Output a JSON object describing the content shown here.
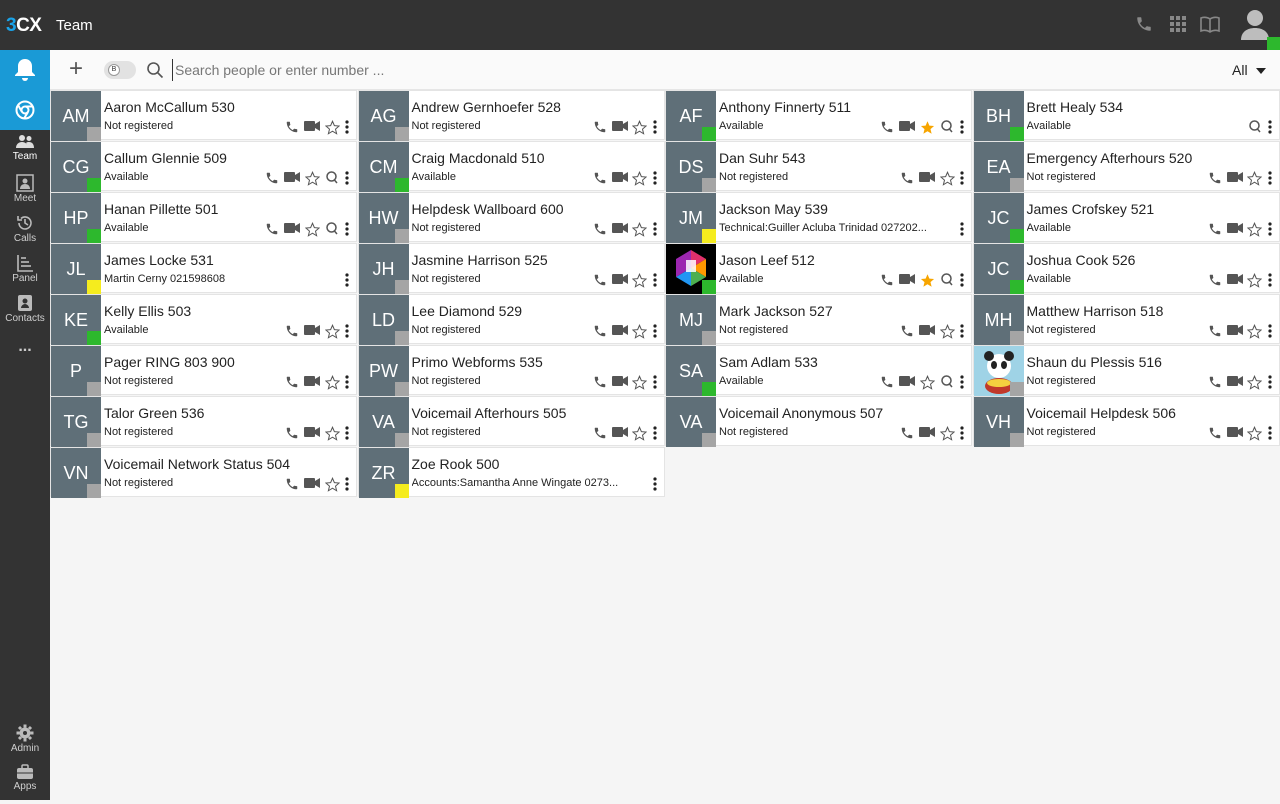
{
  "app": {
    "logo_3": "3",
    "logo_cx": "CX",
    "title": "Team"
  },
  "sidebar": {
    "items": [
      {
        "name": "notifications",
        "label": ""
      },
      {
        "name": "chrome-extension",
        "label": ""
      },
      {
        "name": "team",
        "label": "Team"
      },
      {
        "name": "meet",
        "label": "Meet"
      },
      {
        "name": "calls",
        "label": "Calls"
      },
      {
        "name": "panel",
        "label": "Panel"
      },
      {
        "name": "contacts",
        "label": "Contacts"
      },
      {
        "name": "more",
        "label": "..."
      },
      {
        "name": "admin",
        "label": "Admin"
      },
      {
        "name": "apps",
        "label": "Apps"
      }
    ]
  },
  "toolbar": {
    "add": "+",
    "toggle_label": "B",
    "search_placeholder": "Search people or enter number ...",
    "filter": "All"
  },
  "colors": {
    "topbar": "#333333",
    "accent": "#1a9ad6",
    "available": "#2db82d",
    "offline": "#a5a5a5",
    "busy": "#f5ec1e",
    "favorite": "#f7a500"
  },
  "contacts": [
    {
      "initials": "AM",
      "name": "Aaron McCallum 530",
      "status": "Not registered",
      "presence": "gray",
      "actions": [
        "phone",
        "video",
        "star",
        "more"
      ]
    },
    {
      "initials": "AG",
      "name": "Andrew Gernhoefer 528",
      "status": "Not registered",
      "presence": "gray",
      "actions": [
        "phone",
        "video",
        "star",
        "more"
      ]
    },
    {
      "initials": "AF",
      "name": "Anthony Finnerty 511",
      "status": "Available",
      "presence": "green",
      "actions": [
        "phone",
        "video",
        "star-filled",
        "queue",
        "more"
      ]
    },
    {
      "initials": "BH",
      "name": "Brett Healy 534",
      "status": "Available",
      "presence": "green",
      "actions": [
        "queue",
        "more"
      ]
    },
    {
      "initials": "CG",
      "name": "Callum Glennie 509",
      "status": "Available",
      "presence": "green",
      "actions": [
        "phone",
        "video",
        "star",
        "queue",
        "more"
      ]
    },
    {
      "initials": "CM",
      "name": "Craig Macdonald 510",
      "status": "Available",
      "presence": "green",
      "actions": [
        "phone",
        "video",
        "star",
        "more"
      ]
    },
    {
      "initials": "DS",
      "name": "Dan Suhr 543",
      "status": "Not registered",
      "presence": "gray",
      "actions": [
        "phone",
        "video",
        "star",
        "more"
      ]
    },
    {
      "initials": "EA",
      "name": "Emergency Afterhours 520",
      "status": "Not registered",
      "presence": "gray",
      "actions": [
        "phone",
        "video",
        "star",
        "more"
      ]
    },
    {
      "initials": "HP",
      "name": "Hanan Pillette 501",
      "status": "Available",
      "presence": "green",
      "actions": [
        "phone",
        "video",
        "star",
        "queue",
        "more"
      ]
    },
    {
      "initials": "HW",
      "name": "Helpdesk Wallboard 600",
      "status": "Not registered",
      "presence": "gray",
      "actions": [
        "phone",
        "video",
        "star",
        "more"
      ]
    },
    {
      "initials": "JM",
      "name": "Jackson May 539",
      "status": "Technical:Guiller Acluba Trinidad 027202...",
      "presence": "yellow",
      "actions": [
        "more"
      ]
    },
    {
      "initials": "JC",
      "name": "James Crofskey 521",
      "status": "Available",
      "presence": "green",
      "actions": [
        "phone",
        "video",
        "star",
        "more"
      ]
    },
    {
      "initials": "JL",
      "name": "James Locke 531",
      "status": "Martin Cerny 021598608",
      "presence": "yellow",
      "actions": [
        "more"
      ]
    },
    {
      "initials": "JH",
      "name": "Jasmine Harrison 525",
      "status": "Not registered",
      "presence": "gray",
      "actions": [
        "phone",
        "video",
        "star",
        "more"
      ]
    },
    {
      "initials": "",
      "name": "Jason Leef 512",
      "status": "Available",
      "presence": "green",
      "avatar": "logo",
      "actions": [
        "phone",
        "video",
        "star-filled",
        "queue",
        "more"
      ]
    },
    {
      "initials": "JC",
      "name": "Joshua Cook 526",
      "status": "Available",
      "presence": "green",
      "actions": [
        "phone",
        "video",
        "star",
        "more"
      ]
    },
    {
      "initials": "KE",
      "name": "Kelly Ellis 503",
      "status": "Available",
      "presence": "green",
      "actions": [
        "phone",
        "video",
        "star",
        "more"
      ]
    },
    {
      "initials": "LD",
      "name": "Lee Diamond 529",
      "status": "Not registered",
      "presence": "gray",
      "actions": [
        "phone",
        "video",
        "star",
        "more"
      ]
    },
    {
      "initials": "MJ",
      "name": "Mark Jackson 527",
      "status": "Not registered",
      "presence": "gray",
      "actions": [
        "phone",
        "video",
        "star",
        "more"
      ]
    },
    {
      "initials": "MH",
      "name": "Matthew Harrison 518",
      "status": "Not registered",
      "presence": "gray",
      "actions": [
        "phone",
        "video",
        "star",
        "more"
      ]
    },
    {
      "initials": "P",
      "name": "Pager RING 803 900",
      "status": "Not registered",
      "presence": "gray",
      "actions": [
        "phone",
        "video",
        "star",
        "more"
      ]
    },
    {
      "initials": "PW",
      "name": "Primo Webforms 535",
      "status": "Not registered",
      "presence": "gray",
      "actions": [
        "phone",
        "video",
        "star",
        "more"
      ]
    },
    {
      "initials": "SA",
      "name": "Sam Adlam 533",
      "status": "Available",
      "presence": "green",
      "actions": [
        "phone",
        "video",
        "star",
        "queue",
        "more"
      ]
    },
    {
      "initials": "",
      "name": "Shaun du Plessis 516",
      "status": "Not registered",
      "presence": "gray",
      "avatar": "panda",
      "actions": [
        "phone",
        "video",
        "star",
        "more"
      ]
    },
    {
      "initials": "TG",
      "name": "Talor Green 536",
      "status": "Not registered",
      "presence": "gray",
      "actions": [
        "phone",
        "video",
        "star",
        "more"
      ]
    },
    {
      "initials": "VA",
      "name": "Voicemail Afterhours 505",
      "status": "Not registered",
      "presence": "gray",
      "actions": [
        "phone",
        "video",
        "star",
        "more"
      ]
    },
    {
      "initials": "VA",
      "name": "Voicemail Anonymous 507",
      "status": "Not registered",
      "presence": "gray",
      "actions": [
        "phone",
        "video",
        "star",
        "more"
      ]
    },
    {
      "initials": "VH",
      "name": "Voicemail Helpdesk 506",
      "status": "Not registered",
      "presence": "gray",
      "actions": [
        "phone",
        "video",
        "star",
        "more"
      ]
    },
    {
      "initials": "VN",
      "name": "Voicemail Network Status 504",
      "status": "Not registered",
      "presence": "gray",
      "actions": [
        "phone",
        "video",
        "star",
        "more"
      ]
    },
    {
      "initials": "ZR",
      "name": "Zoe Rook 500",
      "status": "Accounts:Samantha Anne Wingate 0273...",
      "presence": "yellow",
      "actions": [
        "more"
      ]
    }
  ]
}
